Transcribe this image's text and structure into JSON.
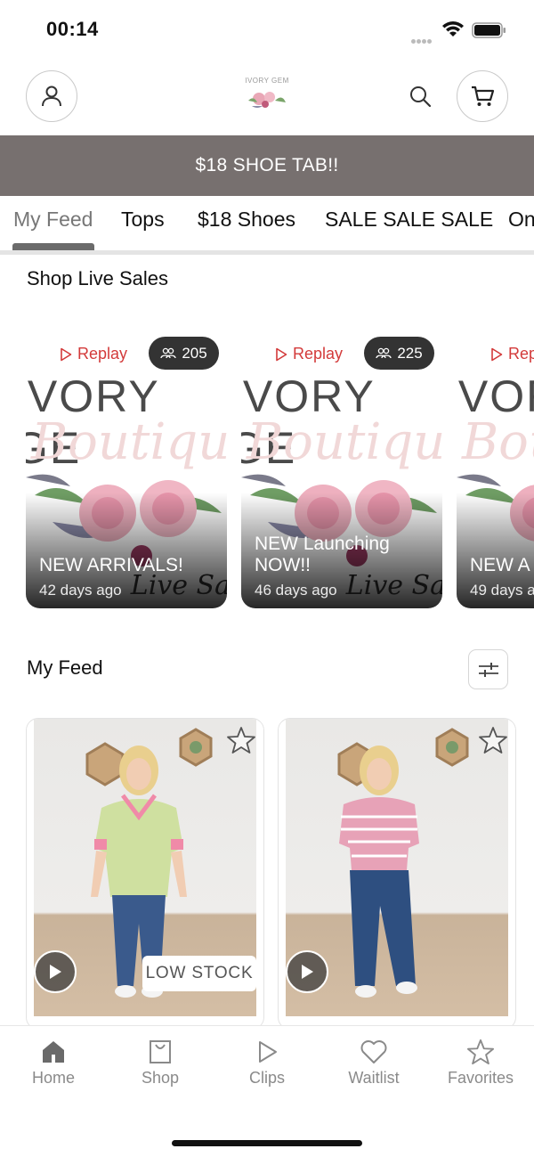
{
  "status_bar": {
    "time": "00:14"
  },
  "header": {
    "logo_text": "IVORY GEM"
  },
  "promo_banner": "$18 SHOE TAB!!",
  "tabs": [
    {
      "label": "My Feed",
      "active": true
    },
    {
      "label": "Tops"
    },
    {
      "label": "$18 Shoes"
    },
    {
      "label": "SALE SALE SALE"
    },
    {
      "label": "On"
    }
  ],
  "live_sales": {
    "title": "Shop Live Sales",
    "cards": [
      {
        "replay": "Replay",
        "viewers": "205",
        "brand": "IVORY GE",
        "script": "Boutique",
        "title": "NEW ARRIVALS!",
        "age": "42 days ago",
        "live_script": "Live Sa"
      },
      {
        "replay": "Replay",
        "viewers": "225",
        "brand": "IVORY GE",
        "script": "Boutique",
        "title": "NEW Launching NOW!!",
        "age": "46 days ago",
        "live_script": "Live Sa"
      },
      {
        "replay": "Rep",
        "viewers": "",
        "brand": "IVOR",
        "script": "Bou",
        "title": "NEW A",
        "age": "49 days a",
        "live_script": ""
      }
    ]
  },
  "feed": {
    "title": "My Feed",
    "products": [
      {
        "badge": "LOW STOCK",
        "shirt_color": "#cfe0a0",
        "trim_color": "#f08aa8"
      },
      {
        "badge": "",
        "shirt_color": "#e7a2b7",
        "trim_color": "#ffffff"
      }
    ]
  },
  "bottom_nav": [
    {
      "label": "Home",
      "icon": "home-icon",
      "active": true
    },
    {
      "label": "Shop",
      "icon": "shopping-bag-icon"
    },
    {
      "label": "Clips",
      "icon": "play-icon"
    },
    {
      "label": "Waitlist",
      "icon": "heart-icon"
    },
    {
      "label": "Favorites",
      "icon": "star-icon"
    }
  ],
  "colors": {
    "promo_bg": "#77706f",
    "replay_red": "#d33a3a",
    "nav_inactive": "#8a8a8a"
  }
}
